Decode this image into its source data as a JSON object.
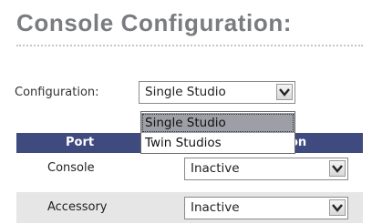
{
  "page": {
    "title": "Console Configuration:"
  },
  "configuration": {
    "label": "Configuration:",
    "selected": "Single Studio",
    "options": [
      "Single Studio",
      "Twin Studios"
    ]
  },
  "table": {
    "headers": [
      "Port",
      "on"
    ],
    "rows": [
      {
        "port": "Console",
        "status": "Inactive"
      },
      {
        "port": "Accessory",
        "status": "Inactive"
      }
    ]
  },
  "icons": {
    "dropdown_arrow": "chevron-down-icon"
  },
  "colors": {
    "header_bg": "#3f4a7e",
    "title": "#7a7c80",
    "highlight": "#9c9fa6",
    "row_alt": "#e6e6e6"
  }
}
